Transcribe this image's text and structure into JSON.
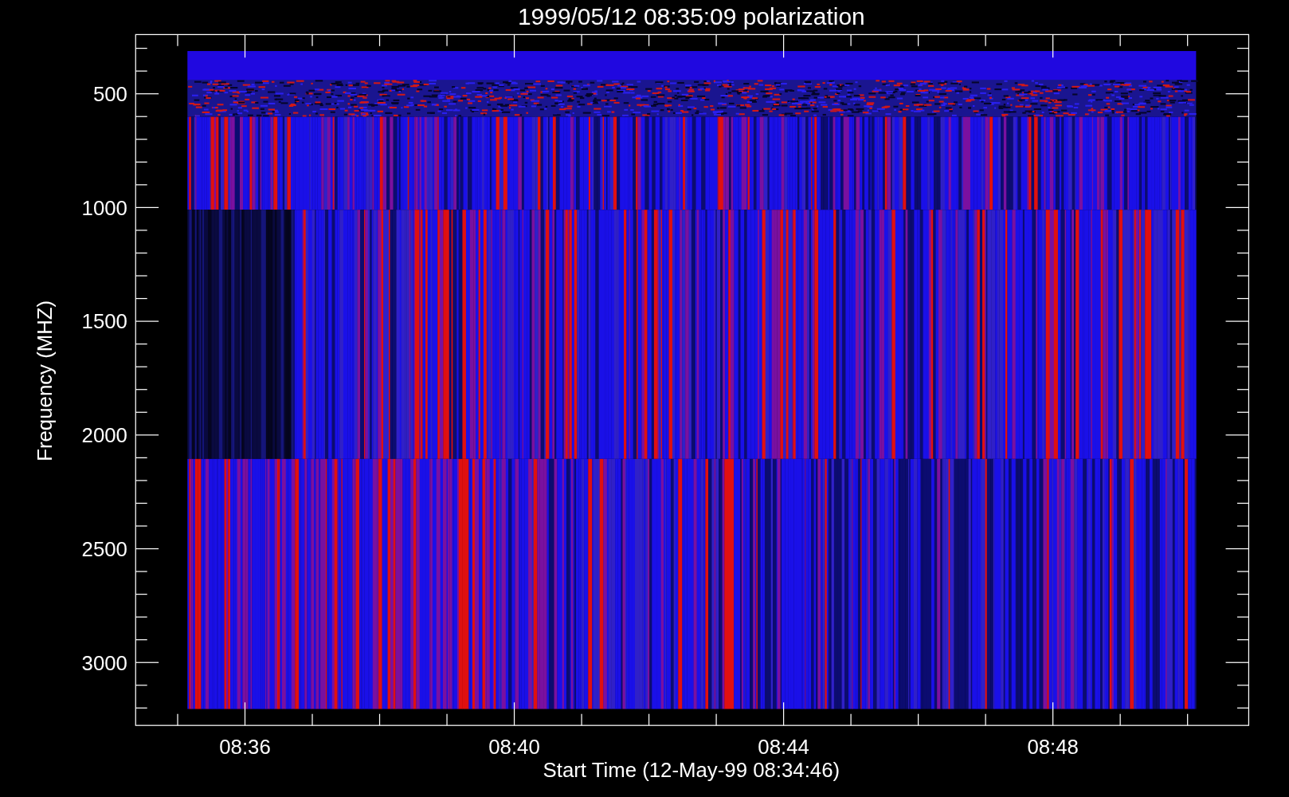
{
  "plot": {
    "title": "1999/05/12 08:35:09 polarization",
    "x_axis": {
      "label": "Start Time (12-May-99 08:34:46)",
      "tick_labels": [
        "08:36",
        "08:40",
        "08:44",
        "08:48"
      ]
    },
    "y_axis": {
      "label": "Frequency (MHZ)",
      "tick_labels": [
        "500",
        "1000",
        "1500",
        "2000",
        "2500",
        "3000"
      ]
    }
  }
}
